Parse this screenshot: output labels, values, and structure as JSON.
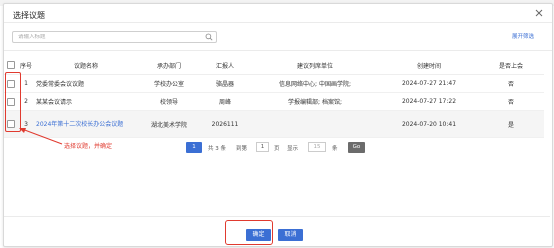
{
  "dialog": {
    "title": "选择议题"
  },
  "search": {
    "placeholder": "请输入标题"
  },
  "expand_filter": "展开筛选",
  "table": {
    "headers": [
      "序号",
      "议题名称",
      "承办部门",
      "汇报人",
      "建议列席单位",
      "创建时间",
      "是否上会"
    ],
    "rows": [
      {
        "no": "1",
        "title": "党委常委会议议题",
        "dept": "学校办公室",
        "reporter": "骆晶器",
        "units": "信息网络中心; 中国画学院;",
        "created": "2024-07-27 21:47",
        "meeting": "否"
      },
      {
        "no": "2",
        "title": "某某会议请示",
        "dept": "校领导",
        "reporter": "周峰",
        "units": "学报编辑部; 档案馆;",
        "created": "2024-07-27 17:22",
        "meeting": "否"
      },
      {
        "no": "3",
        "title": "2024年第十二次校长办公会议题",
        "dept": "湖北美术学院",
        "reporter": "2026111",
        "units": "",
        "created": "2024-07-20 10:41",
        "meeting": "是"
      }
    ]
  },
  "annotation": "选择议题，并确定",
  "pager": {
    "current_page": "1",
    "total": "共 3 条",
    "goto_label": "到第",
    "goto_value": "1",
    "page_unit": "页",
    "show_label": "显示",
    "page_size": "15",
    "size_unit": "条",
    "go_label": "Go"
  },
  "footer": {
    "ok_label": "确定",
    "cancel_label": "取消"
  },
  "colors": {
    "accent": "#3b6fd4",
    "annotation_red": "#e03a2f"
  }
}
